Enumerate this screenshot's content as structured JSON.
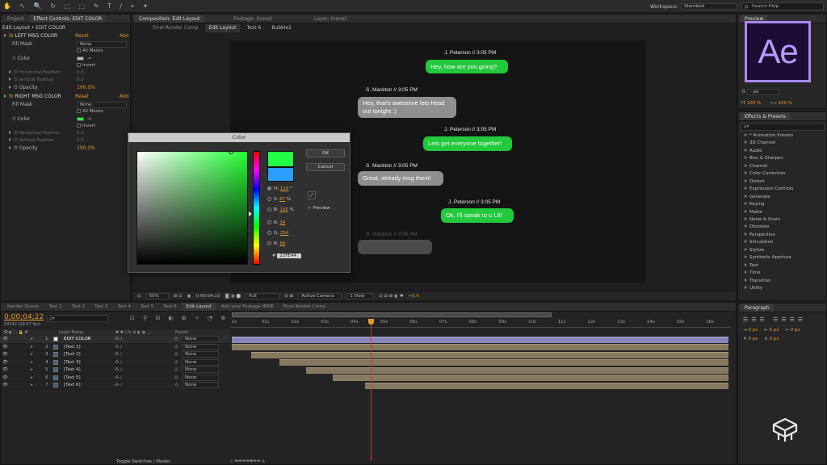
{
  "toolbar": {
    "workspace_label": "Workspace:",
    "workspace_value": "Standard",
    "search_placeholder": "Search Help"
  },
  "project_panel": {
    "tab_project": "Project",
    "tab_effect_controls": "Effect Controls: EDIT COLOR",
    "breadcrumb": "Edit Layout • EDIT COLOR"
  },
  "effects": [
    {
      "name": "LEFT MSG COLOR",
      "reset": "Reset",
      "about": "Abo",
      "fill_mask_label": "Fill Mask",
      "fill_mask_value": "None",
      "all_masks": "All Masks",
      "color_label": "Color",
      "invert": "Invert",
      "h_feather": "Horizontal Feather",
      "h_feather_val": "0.0",
      "v_feather": "Vertical Feather",
      "v_feather_val": "0.0",
      "opacity": "Opacity",
      "opacity_val": "100.0%",
      "swatch": "#bdbdbd"
    },
    {
      "name": "RIGHT MSG COLOR",
      "reset": "Reset",
      "about": "Abo",
      "fill_mask_label": "Fill Mask",
      "fill_mask_value": "None",
      "all_masks": "All Masks",
      "color_label": "Color",
      "invert": "Invert",
      "h_feather": "Horizontal Feather",
      "h_feather_val": "0.0",
      "v_feather": "Vertical Feather",
      "v_feather_val": "0.0",
      "opacity": "Opacity",
      "opacity_val": "100.0%",
      "swatch": "#22fe44"
    }
  ],
  "comp": {
    "tab_composition": "Composition: Edit Layout",
    "tab_footage": "Footage: (none)",
    "tab_layer": "Layer: (none)",
    "breadcrumbs": [
      "Final Render Comp",
      "Edit Layout",
      "Text 6",
      "Bubble2"
    ],
    "zoom": "50%",
    "timecode": "0;00;04;22",
    "resolution": "Full",
    "camera": "Active Camera",
    "views": "1 View",
    "exposure": "+0.0"
  },
  "chat": [
    {
      "side": "right",
      "user": "J. Peterson  // 3:05 PM",
      "msg": "Hey, how are you going?"
    },
    {
      "side": "left",
      "user": "S. Mackton  // 3:05 PM",
      "msg": "Hey, that's awesome lets head out tonight :)"
    },
    {
      "side": "right",
      "user": "J. Peterson  // 3:05 PM",
      "msg": "Lets get everyone together!"
    },
    {
      "side": "left",
      "user": "S. Mackton  // 3:05 PM",
      "msg": "Great, already msg them!"
    },
    {
      "side": "right",
      "user": "J. Peterson  // 3:05 PM",
      "msg": "Ok, I'll speak to u L8!"
    },
    {
      "side": "left",
      "user": "S. Mackton  // 3:05 PM",
      "msg": ""
    }
  ],
  "color_dialog": {
    "title": "Color",
    "ok": "OK",
    "cancel": "Cancel",
    "preview": "Preview",
    "h_label": "H:",
    "h_val": "129",
    "h_unit": "°",
    "s_label": "S:",
    "s_val": "87",
    "s_unit": "%",
    "b_label": "B:",
    "b_val": "100",
    "b_unit": "%",
    "r_label": "R:",
    "r_val": "34",
    "g_label": "G:",
    "g_val": "254",
    "bb_label": "B:",
    "bb_val": "68",
    "hex_label": "#",
    "hex_val": "22FE44",
    "new_color": "#22fe44",
    "old_color": "#2b9dfc"
  },
  "right_panel": {
    "preview_tab": "Preview",
    "logo_text": "Ae",
    "char_px": "- px",
    "tracking": "100 %",
    "scale": "100 %",
    "effects_tab": "Effects & Presets",
    "effects_search": "ρ▾",
    "effects_list": [
      "* Animation Presets",
      "3D Channel",
      "Audio",
      "Blur & Sharpen",
      "Channel",
      "Color Correction",
      "Distort",
      "Expression Controls",
      "Generate",
      "Keying",
      "Matte",
      "Noise & Grain",
      "Obsolete",
      "Perspective",
      "Simulation",
      "Stylize",
      "Synthetic Aperture",
      "Text",
      "Time",
      "Transition",
      "Utility"
    ],
    "paragraph_tab": "Paragraph",
    "para_vals": [
      "0 px",
      "0 px",
      "0 px",
      "0 px",
      "0 px"
    ]
  },
  "timeline": {
    "tabs": [
      "Render Queue",
      "Text 1",
      "Text 2",
      "Text 3",
      "Text 4",
      "Text 5",
      "Text 6",
      "Edit Layout",
      "Add your Footage HERE",
      "Final Render Comp"
    ],
    "timecode": "0;00;04;22",
    "fps": "00142 (29.97 fps)",
    "col_layer_name": "Layer Name",
    "col_parent": "Parent",
    "ruler": [
      "0s",
      "01s",
      "02s",
      "03s",
      "04s",
      "05s",
      "06s",
      "07s",
      "08s",
      "09s",
      "10s",
      "11s",
      "12s",
      "13s",
      "14s",
      "15s",
      "16s"
    ],
    "toggle_label": "Toggle Switches / Modes",
    "layers": [
      {
        "num": "1",
        "name": "EDIT COLOR",
        "parent": "None",
        "start": 0.0
      },
      {
        "num": "2",
        "name": "[Text 1]",
        "parent": "None",
        "start": 0.0
      },
      {
        "num": "3",
        "name": "[Text 2]",
        "parent": "None",
        "start": 0.65
      },
      {
        "num": "4",
        "name": "[Text 3]",
        "parent": "None",
        "start": 1.6
      },
      {
        "num": "5",
        "name": "[Text 4]",
        "parent": "None",
        "start": 2.5
      },
      {
        "num": "6",
        "name": "[Text 5]",
        "parent": "None",
        "start": 3.4
      },
      {
        "num": "7",
        "name": "[Text 6]",
        "parent": "None",
        "start": 4.5
      }
    ]
  }
}
